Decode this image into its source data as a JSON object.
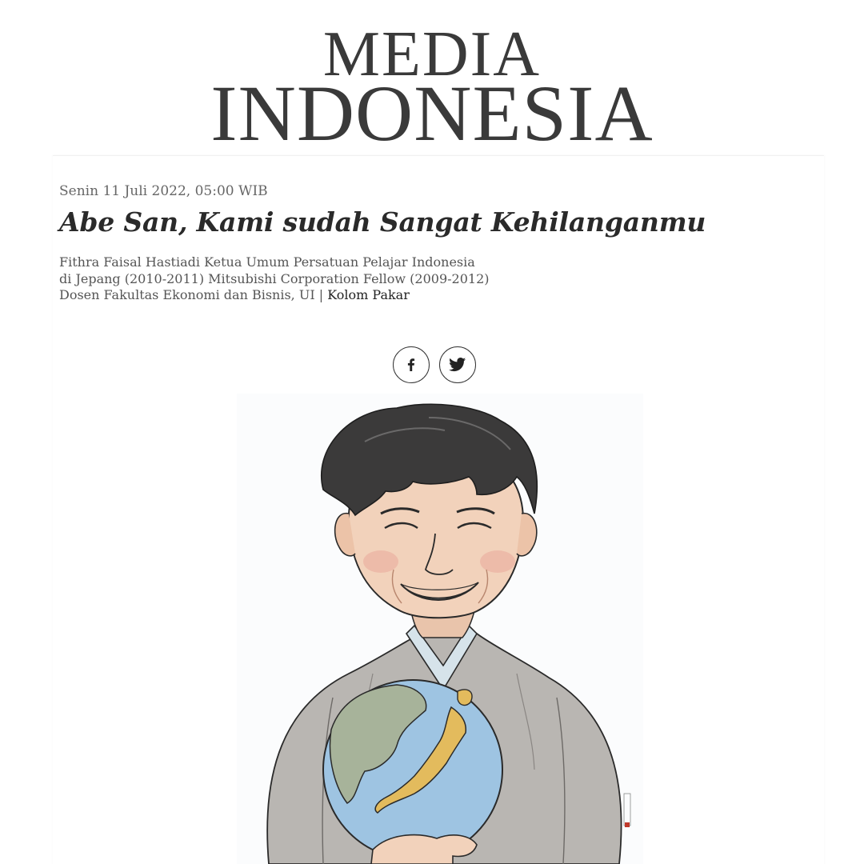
{
  "masthead": {
    "logo_line1": "MEDIA",
    "logo_line2": "INDONESIA"
  },
  "article": {
    "dateline": "Senin 11 Juli 2022, 05:00 WIB",
    "title": "Abe San, Kami sudah Sangat Kehilanganmu",
    "byline_author": "Fithra Faisal Hastiadi Ketua Umum Persatuan Pelajar Indonesia di Jepang (2010-2011) Mitsubishi Corporation Fellow (2009-2012) Dosen Fakultas Ekonomi dan Bisnis, UI",
    "byline_separator": "|",
    "category_link": "Kolom Pakar"
  },
  "share": {
    "facebook_icon": "facebook-icon",
    "twitter_icon": "twitter-icon"
  },
  "illustration": {
    "subject": "caricature-portrait-holding-globe",
    "colors": {
      "hair": "#3b3a3a",
      "skin": "#f2d2bb",
      "robe": "#b9b6b2",
      "inner_collar": "#d6e3ea",
      "globe_ocean": "#9ec4e2",
      "globe_land_japan": "#e3bb5d",
      "globe_land_korea": "#a7b39a"
    }
  }
}
